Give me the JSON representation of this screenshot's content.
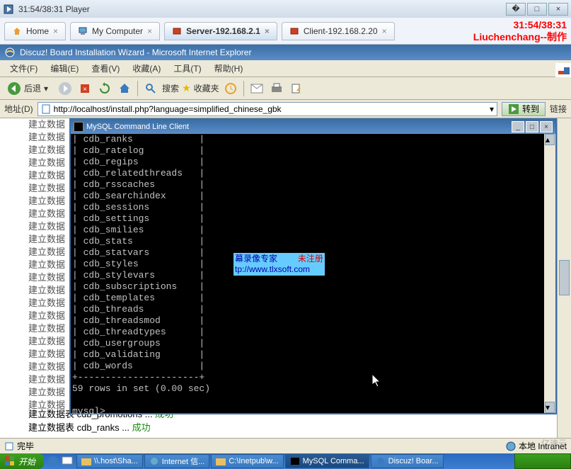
{
  "outer": {
    "title": "31:54/38:31 Player",
    "time_display": "31:54/38:31",
    "author": "Liuchenchang--制作"
  },
  "vmtabs": [
    {
      "icon": "home",
      "label": "Home"
    },
    {
      "icon": "computer",
      "label": "My Computer"
    },
    {
      "icon": "vm",
      "label": "Server-192.168.2.1",
      "active": true
    },
    {
      "icon": "vm",
      "label": "Client-192.168.2.20"
    }
  ],
  "ie": {
    "title": "Discuz! Board Installation Wizard - Microsoft Internet Explorer",
    "menu": [
      "文件(F)",
      "编辑(E)",
      "查看(V)",
      "收藏(A)",
      "工具(T)",
      "帮助(H)"
    ],
    "toolbar": {
      "back": "后退",
      "search": "搜索",
      "favorites": "收藏夹"
    },
    "addr_label": "地址(D)",
    "url": "http://localhost/install.php?language=simplified_chinese_gbk",
    "go": "转到",
    "links": "链接",
    "status": "完毕",
    "zone": "本地 Intranet"
  },
  "page": {
    "building_label": "建立数据",
    "bottom1_prefix": "建立数据表 cdb_promotions ... ",
    "bottom2_prefix": "建立数据表 cdb_ranks ... ",
    "ok": "成功"
  },
  "cmd": {
    "title": "MySQL Command Line Client",
    "tables": [
      "cdb_ranks",
      "cdb_ratelog",
      "cdb_regips",
      "cdb_relatedthreads",
      "cdb_rsscaches",
      "cdb_searchindex",
      "cdb_sessions",
      "cdb_settings",
      "cdb_smilies",
      "cdb_stats",
      "cdb_statvars",
      "cdb_styles",
      "cdb_stylevars",
      "cdb_subscriptions",
      "cdb_templates",
      "cdb_threads",
      "cdb_threadsmod",
      "cdb_threadtypes",
      "cdb_usergroups",
      "cdb_validating",
      "cdb_words"
    ],
    "footer": "59 rows in set (0.00 sec)",
    "prompt": "mysql>"
  },
  "watermark": {
    "line1a": "幕录像专家",
    "line1b": "未注册",
    "line2": "tp://www.tlxsoft.com"
  },
  "taskbar": {
    "start": "开始",
    "tasks": [
      "\\\\.host\\Sha...",
      "Internet 信...",
      "C:\\Inetpub\\w...",
      "MySQL Comma...",
      "Discuz! Boar..."
    ]
  },
  "watermark_corner": "亿速云"
}
